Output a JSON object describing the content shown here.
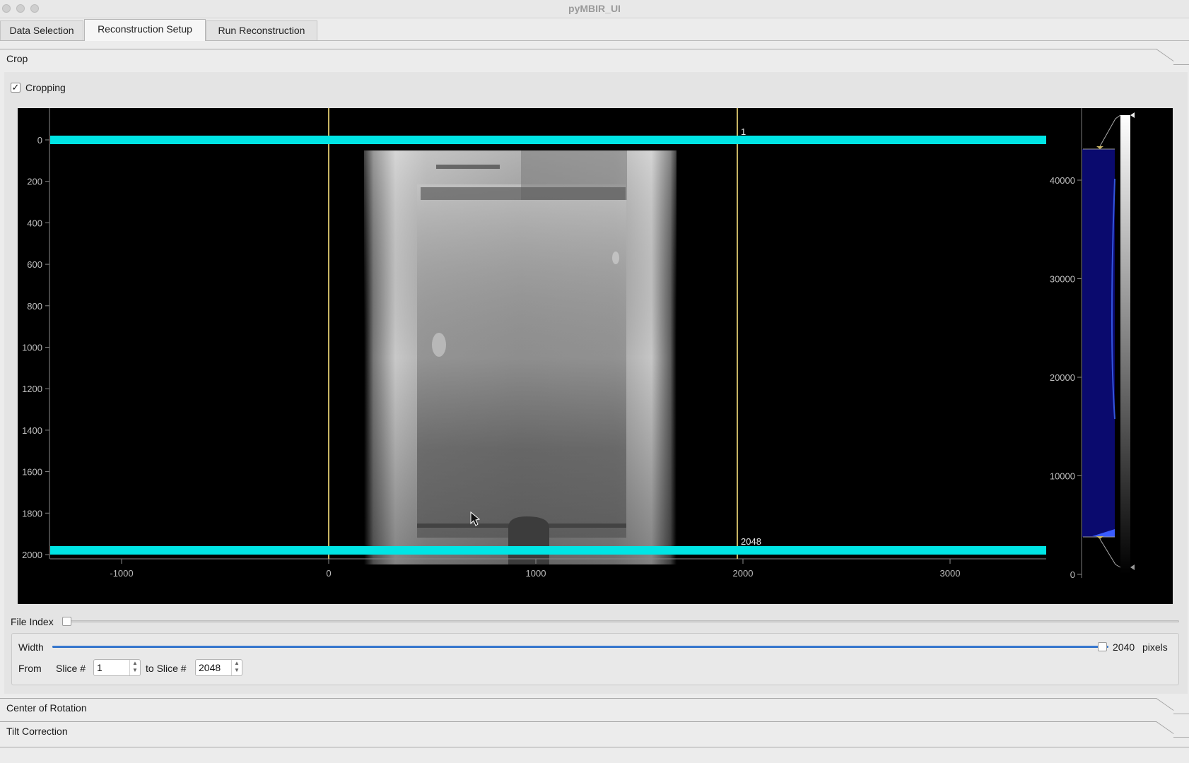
{
  "window": {
    "title": "pyMBIR_UI"
  },
  "tabs": [
    {
      "label": "Data Selection"
    },
    {
      "label": "Reconstruction Setup"
    },
    {
      "label": "Run Reconstruction"
    }
  ],
  "sections": {
    "crop": "Crop",
    "center_of_rotation": "Center of Rotation",
    "tilt_correction": "Tilt Correction"
  },
  "crop": {
    "cropping_label": "Cropping",
    "cropping_checked": true,
    "checkmark": "✓",
    "file_index_label": "File Index",
    "file_index_position": 0,
    "width_label": "Width",
    "width_value": "2040",
    "width_fraction": 1.0,
    "width_unit": "pixels",
    "from_label": "From",
    "slice_label": "Slice #",
    "slice_from": "1",
    "to_slice_label": "to Slice #",
    "slice_to": "2048"
  },
  "image_view": {
    "x_ticks": [
      "-1000",
      "0",
      "1000",
      "2000",
      "3000"
    ],
    "y_ticks": [
      "0",
      "200",
      "400",
      "600",
      "800",
      "1000",
      "1200",
      "1400",
      "1600",
      "1800",
      "2000"
    ],
    "colorbar_ticks": [
      "40000",
      "30000",
      "20000",
      "10000",
      "0"
    ],
    "roi_top_label": "1",
    "roi_bottom_label": "2048",
    "roi_color": "#00e5e5",
    "column_line_color": "#c8b464"
  },
  "icons": {
    "close": "traffic-light-close",
    "minimize": "traffic-light-minimize",
    "zoom": "traffic-light-zoom",
    "cursor": "mouse-pointer-icon"
  }
}
